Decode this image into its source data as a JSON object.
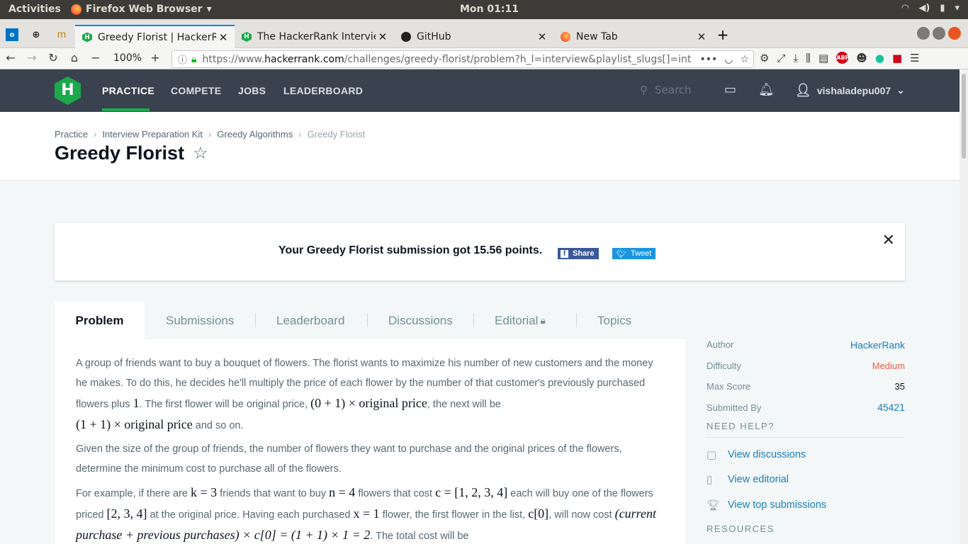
{
  "os": {
    "activities": "Activities",
    "app": "Firefox Web Browser",
    "clock": "Mon 01:11"
  },
  "tabs": [
    {
      "title": "Greedy Florist | HackerRa",
      "active": true
    },
    {
      "title": "The HackerRank Intervie",
      "active": false
    },
    {
      "title": "GitHub",
      "active": false
    },
    {
      "title": "New Tab",
      "active": false
    }
  ],
  "nav": {
    "zoom": "100%",
    "url_prefix": "https://www.",
    "url_host": "hackerrank.com",
    "url_path": "/challenges/greedy-florist/problem?h_l=interview&playlist_slugs[]=int"
  },
  "hr": {
    "logo": "H",
    "nav": [
      "PRACTICE",
      "COMPETE",
      "JOBS",
      "LEADERBOARD"
    ],
    "search_placeholder": "Search",
    "username": "vishaladepu007"
  },
  "breadcrumb": [
    "Practice",
    "Interview Preparation Kit",
    "Greedy Algorithms",
    "Greedy Florist"
  ],
  "page_title": "Greedy Florist",
  "notice": {
    "message": "Your Greedy Florist submission got 15.56 points.",
    "share": "Share",
    "tweet": "Tweet"
  },
  "problem_tabs": [
    "Problem",
    "Submissions",
    "Leaderboard",
    "Discussions",
    "Editorial",
    "Topics"
  ],
  "problem": {
    "p1a": "A group of friends want to buy a bouquet of flowers. The florist wants to maximize his number of new customers and the money he makes. To do this, he decides he'll multiply the price of each flower by the number of that customer's previously purchased flowers plus ",
    "p1_one": "1",
    "p1b": ". The first flower will be original price, ",
    "p1_m1": "(0 + 1) × original price",
    "p1c": ", the next will be ",
    "p1_m2": "(1 + 1) × original price",
    "p1d": " and so on.",
    "p2": "Given the size of the group of friends, the number of flowers they want to purchase and the original prices of the flowers, determine the minimum cost to purchase all of the flowers.",
    "p3a": "For example, if there are ",
    "p3_k": "k = 3",
    "p3b": " friends that want to buy ",
    "p3_n": "n = 4",
    "p3c": " flowers that cost ",
    "p3_c": "c = [1, 2, 3, 4]",
    "p3d": " each will buy one of the flowers priced ",
    "p3_arr": "[2, 3, 4]",
    "p3e": " at the original price. Having each purchased ",
    "p3_x": "x = 1",
    "p3f": " flower, the first flower in the list, ",
    "p3_c0": "c[0]",
    "p3g": ", will now cost ",
    "p3_m": "(current purchase + previous purchases) × c[0] = (1 + 1) × 1 = 2",
    "p3h": ". The total cost will be"
  },
  "sidebar": {
    "rows": [
      {
        "label": "Author",
        "value": "HackerRank"
      },
      {
        "label": "Difficulty",
        "value": "Medium"
      },
      {
        "label": "Max Score",
        "value": "35"
      },
      {
        "label": "Submitted By",
        "value": "45421"
      }
    ],
    "need_help": "NEED HELP?",
    "help_links": [
      "View discussions",
      "View editorial",
      "View top submissions"
    ],
    "resources": "RESOURCES"
  }
}
